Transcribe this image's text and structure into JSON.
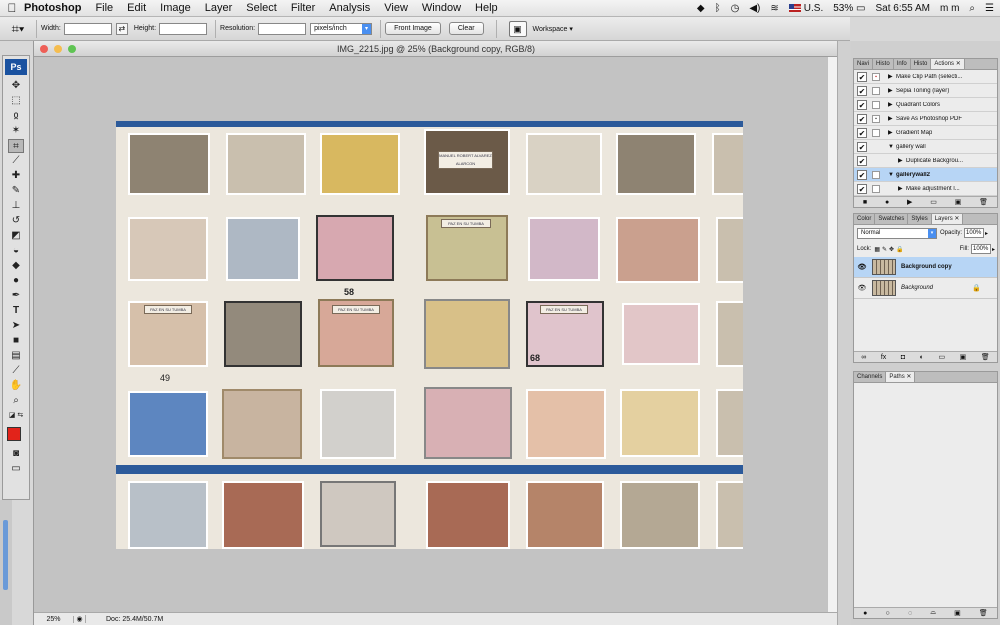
{
  "menubar": {
    "app_name": "Photoshop",
    "items": [
      "File",
      "Edit",
      "Image",
      "Layer",
      "Select",
      "Filter",
      "Analysis",
      "View",
      "Window",
      "Help"
    ],
    "battery": "53%",
    "input_source": "U.S.",
    "clock": "Sat 6:55 AM",
    "user": "m m"
  },
  "options_bar": {
    "width_label": "Width:",
    "height_label": "Height:",
    "resolution_label": "Resolution:",
    "resolution_unit": "pixels/inch",
    "front_image_label": "Front Image",
    "clear_label": "Clear",
    "workspace_label": "Workspace ▾"
  },
  "tools": {
    "logo": "Ps",
    "active": "crop-tool"
  },
  "document": {
    "title": "IMG_2215.jpg @ 25% (Background copy, RGB/8)",
    "zoom": "25%",
    "doc_size": "Doc: 25.4M/50.7M"
  },
  "photo": {
    "plaques": [
      "PAZ EN SU TUMBA",
      "PAZ EN SU TUMBA",
      "PAZ EN SU TUMBA",
      "PAZ EN SU TUMBA",
      "MANUEL ROBERT ALVAREZ ALARCON"
    ],
    "numbers": [
      "58",
      "49",
      "68"
    ]
  },
  "actions_panel": {
    "tabs": [
      "Navi",
      "Histo",
      "Info",
      "Histo",
      "Actions"
    ],
    "active_tab": "Actions",
    "rows": [
      {
        "name": "Make Clip Path (selecti...",
        "dialog": true,
        "indent": 1
      },
      {
        "name": "Sepia Toning (layer)",
        "dialog": false,
        "indent": 1
      },
      {
        "name": "Quadrant Colors",
        "dialog": false,
        "indent": 1
      },
      {
        "name": "Save As Photoshop PDF",
        "dialog": true,
        "indent": 1
      },
      {
        "name": "Gradient Map",
        "dialog": false,
        "indent": 1
      },
      {
        "name": "gallery wall",
        "dialog": false,
        "indent": 0
      },
      {
        "name": "Duplicate Backgrou...",
        "dialog": false,
        "indent": 2
      },
      {
        "name": "gallerywall2",
        "dialog": false,
        "indent": 0,
        "selected": true
      },
      {
        "name": "Make adjustment l...",
        "dialog": false,
        "indent": 2
      }
    ]
  },
  "layers_panel": {
    "tabs": [
      "Color",
      "Swatches",
      "Styles",
      "Layers"
    ],
    "active_tab": "Layers",
    "blend_mode": "Normal",
    "opacity_label": "Opacity:",
    "opacity": "100%",
    "lock_label": "Lock:",
    "fill_label": "Fill:",
    "fill": "100%",
    "layers": [
      {
        "name": "Background copy",
        "selected": true
      },
      {
        "name": "Background",
        "selected": false
      }
    ]
  },
  "paths_panel": {
    "tabs": [
      "Channels",
      "Paths"
    ],
    "active_tab": "Paths"
  },
  "colors": {
    "foreground": "#e2231a",
    "selection": "#b7d5f5",
    "ps_blue": "#1a52a0"
  }
}
